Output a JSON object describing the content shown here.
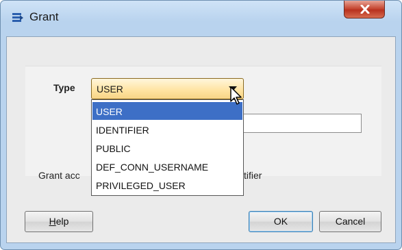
{
  "window": {
    "title": "Grant"
  },
  "form": {
    "type_label": "Type",
    "type_value": "USER",
    "grant_text_left": "Grant acc",
    "grant_text_right": "tifier"
  },
  "dropdown": {
    "options": [
      "USER",
      "IDENTIFIER",
      "PUBLIC",
      "DEF_CONN_USERNAME",
      "PRIVILEGED_USER"
    ],
    "selected": "USER"
  },
  "buttons": {
    "help_mnemonic": "H",
    "help_rest": "elp",
    "ok": "OK",
    "cancel": "Cancel"
  },
  "icons": {
    "title": "grant-list-icon",
    "close": "close-icon"
  },
  "colors": {
    "selection": "#3d6fc6",
    "close_button": "#c74a35",
    "combo_bg": "#ffe3a0"
  }
}
